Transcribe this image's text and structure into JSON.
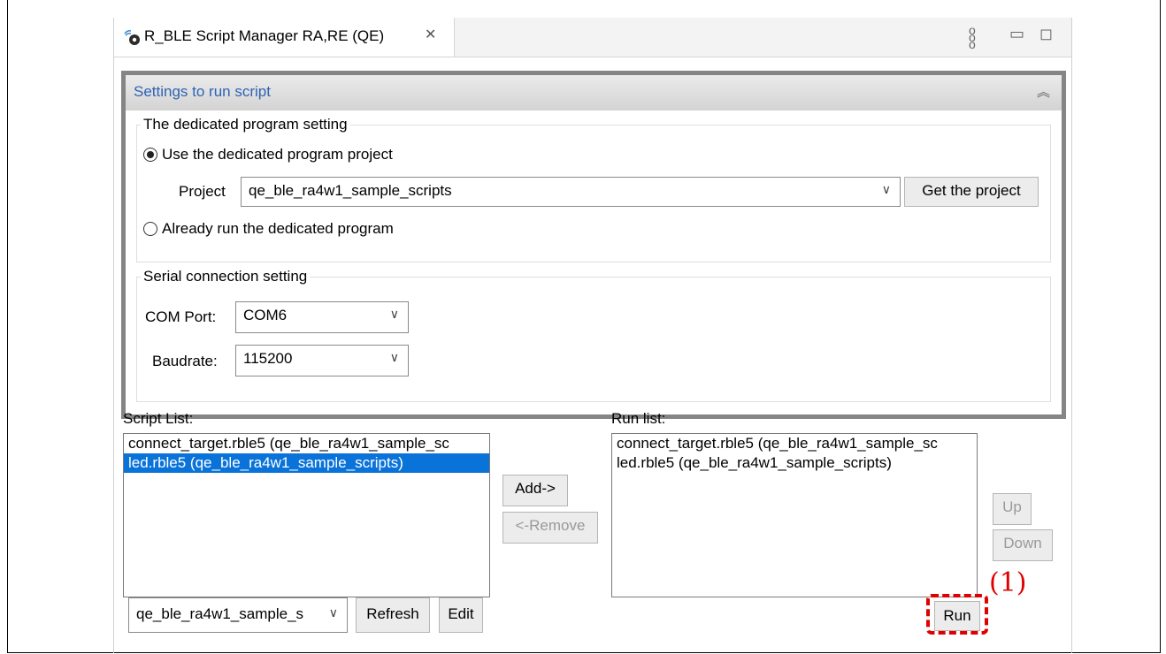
{
  "tab": {
    "title": "R_BLE Script Manager RA,RE (QE)",
    "icon": "ble-plugin-icon"
  },
  "view_toolbar": {
    "menu_icon": "view-menu-icon",
    "minimize_icon": "minimize-icon",
    "maximize_icon": "maximize-icon"
  },
  "settings": {
    "header": "Settings to run script",
    "dedicated": {
      "legend": "The dedicated program setting",
      "use_option": "Use the dedicated program project",
      "project_label": "Project",
      "project_value": "qe_ble_ra4w1_sample_scripts",
      "get_project_button": "Get the project",
      "already_option": "Already run the dedicated program",
      "selected": "use"
    },
    "serial": {
      "legend": "Serial connection setting",
      "com_label": "COM Port:",
      "com_value": "COM6",
      "baud_label": "Baudrate:",
      "baud_value": "115200"
    }
  },
  "script_list": {
    "label": "Script List:",
    "items": [
      "connect_target.rble5 (qe_ble_ra4w1_sample_sc",
      "led.rble5 (qe_ble_ra4w1_sample_scripts)"
    ],
    "selected_index": 1
  },
  "run_list": {
    "label": "Run list:",
    "items": [
      "connect_target.rble5 (qe_ble_ra4w1_sample_sc",
      "led.rble5 (qe_ble_ra4w1_sample_scripts)"
    ]
  },
  "buttons": {
    "add": "Add->",
    "remove": "<-Remove",
    "up": "Up",
    "down": "Down",
    "refresh": "Refresh",
    "edit": "Edit",
    "run": "Run"
  },
  "project_select": {
    "value": "qe_ble_ra4w1_sample_s"
  },
  "annotation": {
    "label": "(1)",
    "color": "#e00000"
  },
  "colors": {
    "selection": "#0a73d9",
    "header_text": "#2e63b5"
  }
}
